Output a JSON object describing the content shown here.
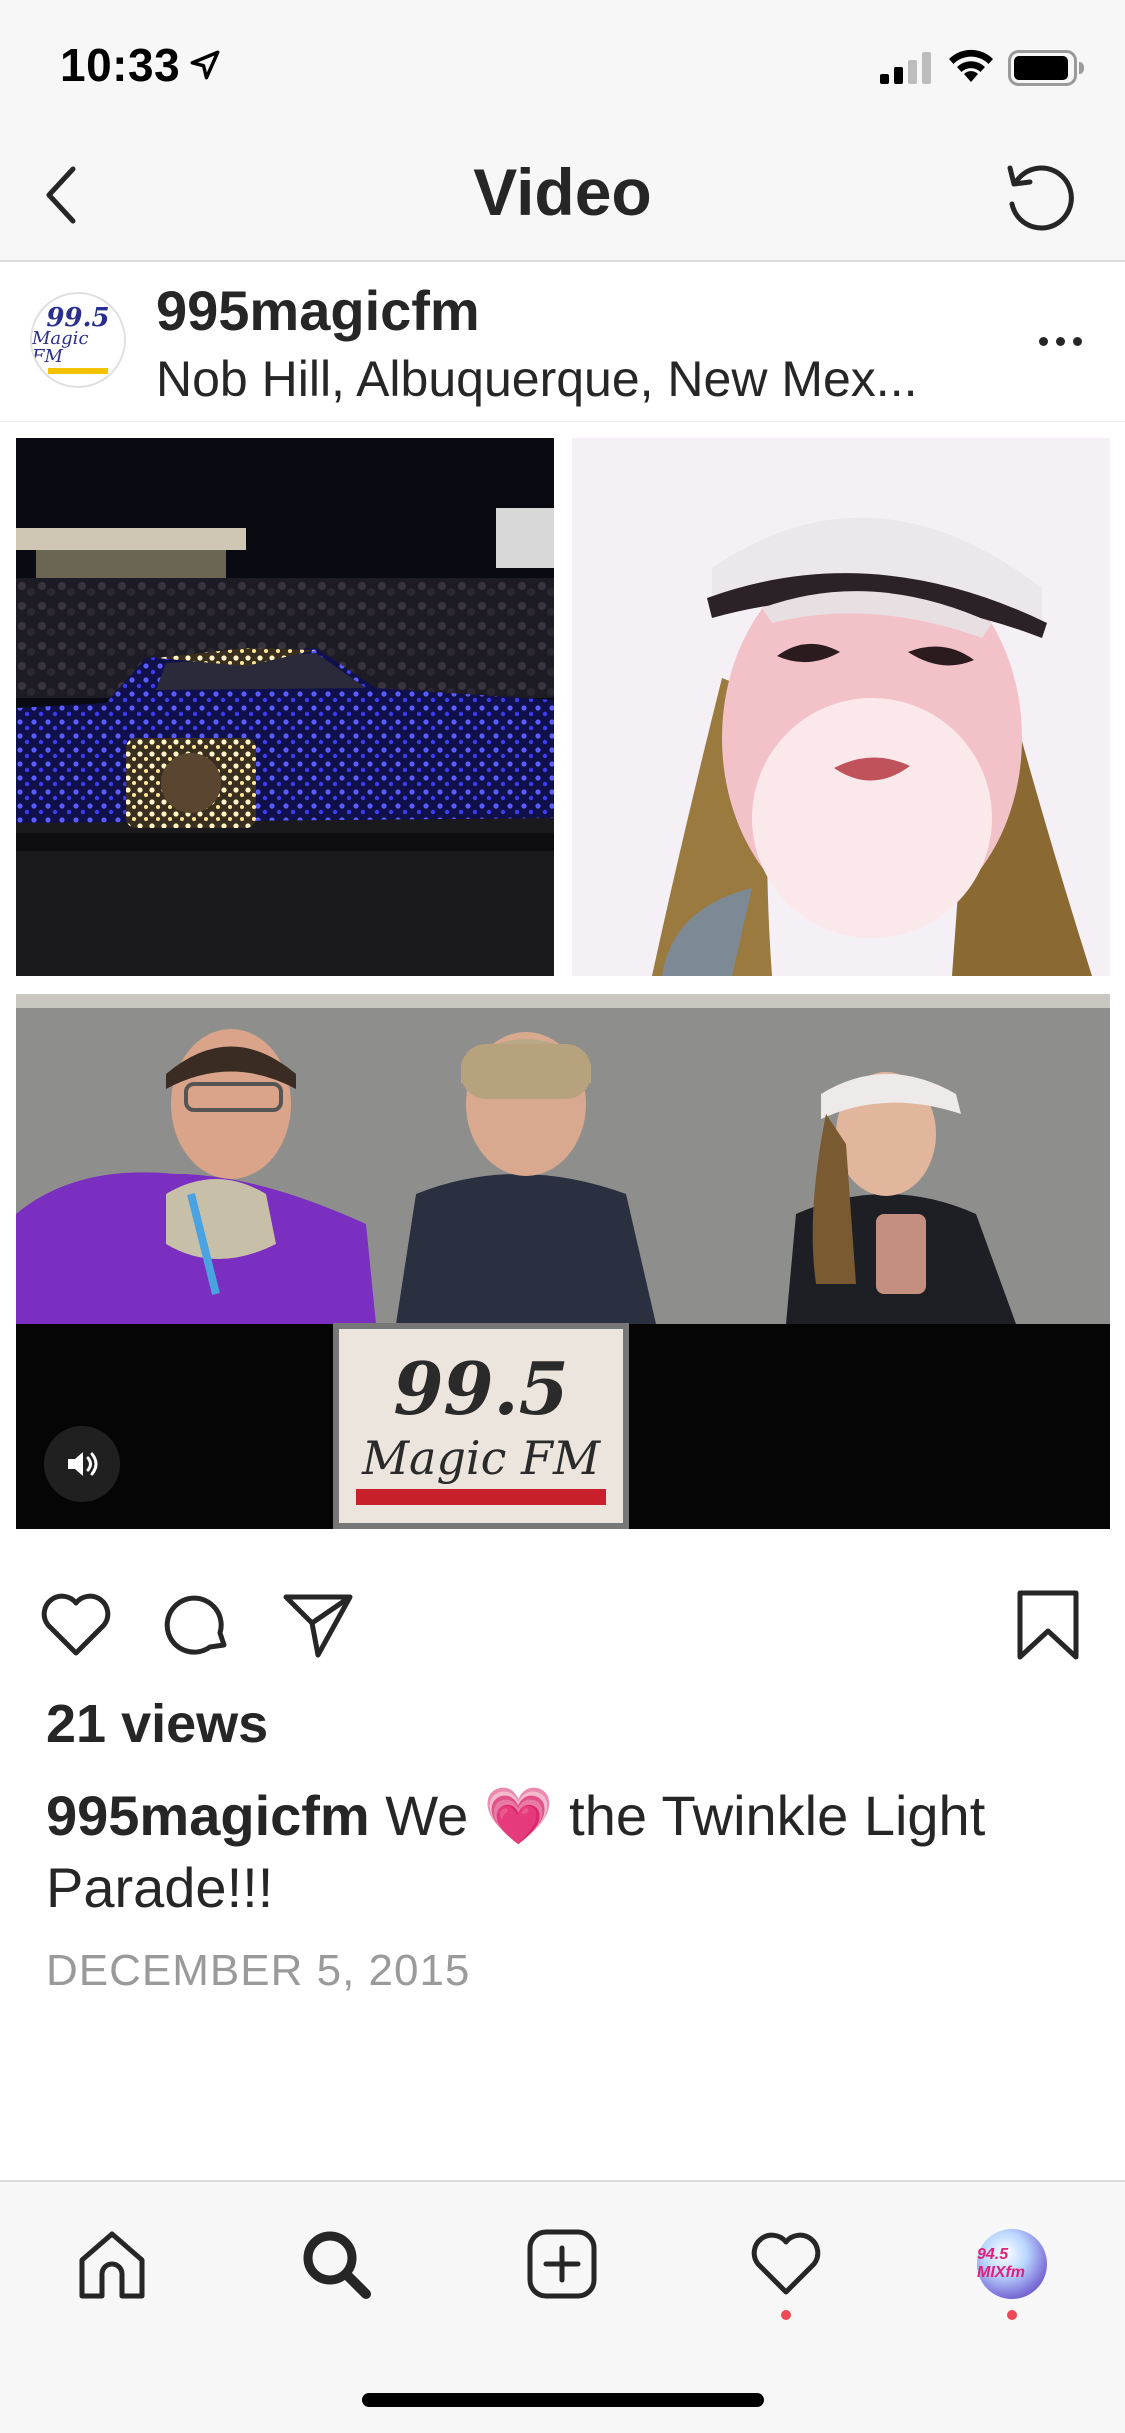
{
  "status_bar": {
    "time": "10:33"
  },
  "nav": {
    "title": "Video"
  },
  "post": {
    "username": "995magicfm",
    "location": "Nob Hill, Albuquerque, New Mex...",
    "avatar_text_top": "99.5",
    "avatar_text_bottom": "Magic FM",
    "media": {
      "sign_text_top": "99.5",
      "sign_text_bottom": "Magic FM",
      "sound": "on"
    },
    "views": "21 views",
    "caption_user": "995magicfm",
    "caption_before_emoji": " We ",
    "caption_emoji": "💗",
    "caption_after_emoji": " the Twinkle Light Parade!!!",
    "date": "DECEMBER 5, 2015"
  },
  "tab_bar": {
    "profile_pic_text": "94.5 MIXfm",
    "activity_dot_color": "#ed4956",
    "profile_dot_color": "#ed4956"
  },
  "icons": [
    "back-chevron-icon",
    "refresh-icon",
    "more-icon",
    "speaker-icon",
    "heart-icon",
    "comment-icon",
    "share-icon",
    "bookmark-icon",
    "home-icon",
    "search-icon",
    "add-icon",
    "activity-heart-icon"
  ]
}
